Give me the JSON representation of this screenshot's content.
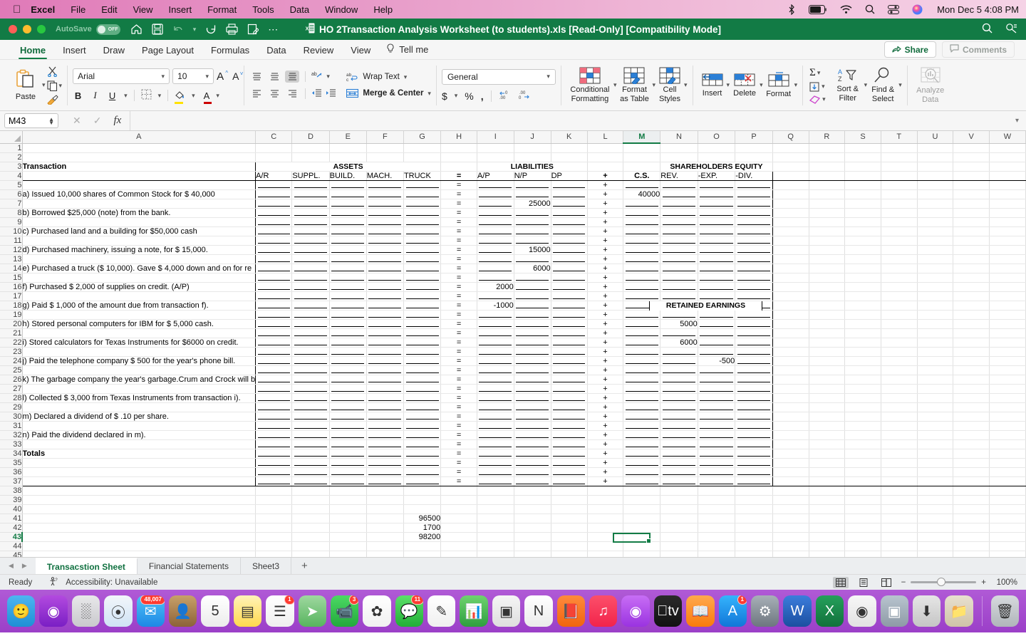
{
  "macos": {
    "apple_icon": "apple-icon",
    "menus": [
      "Excel",
      "File",
      "Edit",
      "View",
      "Insert",
      "Format",
      "Tools",
      "Data",
      "Window",
      "Help"
    ],
    "status_icons": [
      "bluetooth-icon",
      "battery-icon",
      "wifi-icon",
      "search-icon",
      "controlcenter-icon",
      "siri-icon"
    ],
    "clock": "Mon Dec 5  4:08 PM"
  },
  "titlebar": {
    "autosave_label": "AutoSave",
    "autosave_state": "OFF",
    "quick_access": [
      "home-icon",
      "save-icon",
      "undo-icon",
      "undo-chevron-icon",
      "redo-icon",
      "print-icon",
      "quickprint-icon",
      "more-icon"
    ],
    "document_title": "HO 2Transaction Analysis Worksheet (to students).xls  [Read-Only]  [Compatibility Mode]",
    "right_icons": [
      "search-icon",
      "ribbon-display-icon"
    ]
  },
  "ribbon": {
    "tabs": [
      "Home",
      "Insert",
      "Draw",
      "Page Layout",
      "Formulas",
      "Data",
      "Review",
      "View"
    ],
    "active_tab": "Home",
    "tell_me": "Tell me",
    "share_label": "Share",
    "comments_label": "Comments",
    "clipboard": {
      "paste_label": "Paste",
      "cut_label": "cut-icon",
      "copy_label": "copy-icon",
      "format_painter_label": "format-painter-icon"
    },
    "font": {
      "family": "Arial",
      "size": "10",
      "grow_label": "A",
      "shrink_label": "A",
      "bold": "B",
      "italic": "I",
      "underline": "U"
    },
    "alignment": {
      "wrap_text": "Wrap Text",
      "merge_center": "Merge & Center"
    },
    "number": {
      "format": "General",
      "currency": "$",
      "percent": "%",
      "comma": ","
    },
    "styles": {
      "conditional_formatting": "Conditional\nFormatting",
      "conditional_formatting_l1": "Conditional",
      "conditional_formatting_l2": "Formatting",
      "format_as_table_l1": "Format",
      "format_as_table_l2": "as Table",
      "cell_styles_l1": "Cell",
      "cell_styles_l2": "Styles"
    },
    "cells": {
      "insert": "Insert",
      "delete": "Delete",
      "format": "Format"
    },
    "editing": {
      "sort_filter_l1": "Sort &",
      "sort_filter_l2": "Filter",
      "find_select_l1": "Find &",
      "find_select_l2": "Select"
    },
    "analyze": {
      "l1": "Analyze",
      "l2": "Data"
    }
  },
  "formula_bar": {
    "name_box": "M43",
    "cancel_icon": "close-icon",
    "confirm_icon": "check-icon",
    "function_icon": "fx-icon",
    "value": ""
  },
  "grid": {
    "columns": [
      "A",
      "C",
      "D",
      "E",
      "F",
      "G",
      "H",
      "I",
      "J",
      "K",
      "L",
      "M",
      "N",
      "O",
      "P",
      "Q",
      "R",
      "S",
      "T",
      "U",
      "V",
      "W"
    ],
    "selected_column": "M",
    "selected_cell": "M43",
    "rows": [
      1,
      2,
      3,
      4,
      5,
      6,
      7,
      8,
      9,
      10,
      11,
      12,
      13,
      14,
      15,
      16,
      17,
      18,
      19,
      20,
      21,
      22,
      23,
      24,
      25,
      26,
      27,
      28,
      29,
      30,
      31,
      32,
      33,
      34,
      35,
      36,
      37,
      38,
      39,
      40,
      41,
      42,
      43,
      44,
      45
    ],
    "selected_row": 43,
    "headers": {
      "transaction": "Transaction",
      "assets": "ASSETS",
      "liabilities": "LIABILITIES",
      "shareholders_equity": "SHAREHOLDERS EQUITY",
      "retained_earnings": "RETAINED EARNINGS",
      "col_ar": "A/R",
      "col_suppl": "SUPPL.",
      "col_build": "BUILD.",
      "col_mach": "MACH.",
      "col_truck": "TRUCK",
      "col_eq": "=",
      "col_ap": "A/P",
      "col_np": "N/P",
      "col_dp": "DP",
      "col_plus": "+",
      "col_cs": "C.S.",
      "col_rev": "REV.",
      "col_exp": "-EXP.",
      "col_div": "-DIV."
    },
    "transactions": [
      {
        "row": 6,
        "text": "a) Issued 10,000 shares of Common Stock for $ 40,000"
      },
      {
        "row": 8,
        "text": "b) Borrowed $25,000 (note) from the bank."
      },
      {
        "row": 10,
        "text": "c) Purchased land and a building for $50,000 cash"
      },
      {
        "row": 12,
        "text": "d) Purchased machinery, issuing a note, for $ 15,000."
      },
      {
        "row": 14,
        "text": "e) Purchased a truck ($ 10,000). Gave $ 4,000 down and on for re"
      },
      {
        "row": 16,
        "text": "f) Purchased $ 2,000 of supplies on credit. (A/P)"
      },
      {
        "row": 18,
        "text": "g) Paid $ 1,000 of the amount due from transaction f)."
      },
      {
        "row": 20,
        "text": "h) Stored personal computers for IBM for $ 5,000 cash."
      },
      {
        "row": 22,
        "text": "i) Stored calculators for Texas Instruments for $6000 on credit."
      },
      {
        "row": 24,
        "text": "j) Paid the telephone company $ 500 for the year's phone bill."
      },
      {
        "row": 26,
        "text": "k) The garbage company the year's garbage.Crum and Crock will b"
      },
      {
        "row": 28,
        "text": "l) Collected $ 3,000 from Texas Instruments  from transaction i)."
      },
      {
        "row": 30,
        "text": "m) Declared a dividend of $ .10 per share."
      },
      {
        "row": 32,
        "text": "n) Paid the dividend declared in m)."
      },
      {
        "row": 34,
        "text": "Totals"
      }
    ],
    "values": [
      {
        "row": 6,
        "col": "M",
        "value": "40000"
      },
      {
        "row": 7,
        "col": "J",
        "value": "25000"
      },
      {
        "row": 12,
        "col": "J",
        "value": "15000"
      },
      {
        "row": 14,
        "col": "J",
        "value": "6000"
      },
      {
        "row": 16,
        "col": "I",
        "value": "2000"
      },
      {
        "row": 18,
        "col": "I",
        "value": "-1000"
      },
      {
        "row": 20,
        "col": "N",
        "value": "5000"
      },
      {
        "row": 22,
        "col": "N",
        "value": "6000"
      },
      {
        "row": 24,
        "col": "O",
        "value": "-500"
      },
      {
        "row": 41,
        "col": "G",
        "value": "96500"
      },
      {
        "row": 42,
        "col": "G",
        "value": "1700"
      },
      {
        "row": 43,
        "col": "G",
        "value": "98200"
      }
    ]
  },
  "sheet_tabs": {
    "tabs": [
      "Transacstion Sheet",
      "Financial Statements",
      "Sheet3"
    ],
    "active": "Transacstion Sheet",
    "add_label": "+",
    "prev_icon": "chevron-left-icon",
    "next_icon": "chevron-right-icon"
  },
  "status_bar": {
    "state": "Ready",
    "accessibility": "Accessibility: Unavailable",
    "views": [
      "normal-view-icon",
      "page-layout-icon",
      "page-break-icon"
    ],
    "active_view": "normal-view-icon",
    "zoom_out": "−",
    "zoom_in": "+",
    "zoom_level": "100%"
  },
  "dock": {
    "items": [
      {
        "name": "finder-icon",
        "color1": "#4eb5f1",
        "color2": "#1e8fd5",
        "glyph": "🙂",
        "badge": ""
      },
      {
        "name": "podcasts-icon",
        "color1": "#b34adf",
        "color2": "#7a1fc4",
        "glyph": "◉",
        "badge": ""
      },
      {
        "name": "launchpad-icon",
        "color1": "#e8e8ea",
        "color2": "#c9c9cd",
        "glyph": "░",
        "badge": ""
      },
      {
        "name": "safari-icon",
        "color1": "#f2f6fa",
        "color2": "#cfe3f5",
        "glyph": "⦿",
        "badge": ""
      },
      {
        "name": "mail-icon",
        "color1": "#4fc3f7",
        "color2": "#1e88e5",
        "glyph": "✉",
        "badge": "48,007"
      },
      {
        "name": "contacts-icon",
        "color1": "#c8a169",
        "color2": "#8c6239",
        "glyph": "👤",
        "badge": ""
      },
      {
        "name": "calendar-icon",
        "color1": "#ffffff",
        "color2": "#ececec",
        "glyph": "5",
        "badge": ""
      },
      {
        "name": "notes-icon",
        "color1": "#fff4b8",
        "color2": "#ffd84d",
        "glyph": "▤",
        "badge": ""
      },
      {
        "name": "reminders-icon",
        "color1": "#ffffff",
        "color2": "#efefef",
        "glyph": "☰",
        "badge": "1"
      },
      {
        "name": "maps-icon",
        "color1": "#9fd8a0",
        "color2": "#57b45e",
        "glyph": "➤",
        "badge": ""
      },
      {
        "name": "facetime-icon",
        "color1": "#4cd964",
        "color2": "#23a93c",
        "glyph": "📹",
        "badge": "3"
      },
      {
        "name": "photos-icon",
        "color1": "#ffffff",
        "color2": "#f0f0f0",
        "glyph": "✿",
        "badge": ""
      },
      {
        "name": "messages-icon",
        "color1": "#5ce06a",
        "color2": "#22ae37",
        "glyph": "💬",
        "badge": "11"
      },
      {
        "name": "freeform-icon",
        "color1": "#ffffff",
        "color2": "#efefef",
        "glyph": "✎",
        "badge": ""
      },
      {
        "name": "numbers-icon",
        "color1": "#6fd36f",
        "color2": "#2e9e3f",
        "glyph": "📊",
        "badge": ""
      },
      {
        "name": "keynote-icon",
        "color1": "#f5f5f5",
        "color2": "#dedede",
        "glyph": "▣",
        "badge": ""
      },
      {
        "name": "news-icon",
        "color1": "#ffffff",
        "color2": "#ebebeb",
        "glyph": "N",
        "badge": ""
      },
      {
        "name": "books-icon",
        "color1": "#ff8a3d",
        "color2": "#f0650e",
        "glyph": "📕",
        "badge": ""
      },
      {
        "name": "music-icon",
        "color1": "#fc4f6a",
        "color2": "#f2244b",
        "glyph": "♫",
        "badge": ""
      },
      {
        "name": "podcast2-icon",
        "color1": "#c86ef5",
        "color2": "#9a33e0",
        "glyph": "◉",
        "badge": ""
      },
      {
        "name": "appletv-icon",
        "color1": "#2b2b2b",
        "color2": "#111111",
        "glyph": "tv",
        "badge": ""
      },
      {
        "name": "ibooks-icon",
        "color1": "#ffa94d",
        "color2": "#f97b0c",
        "glyph": "📖",
        "badge": ""
      },
      {
        "name": "appstore-icon",
        "color1": "#35b4fc",
        "color2": "#1176d8",
        "glyph": "A",
        "badge": "1"
      },
      {
        "name": "settings-icon",
        "color1": "#a8b0b8",
        "color2": "#6d767f",
        "glyph": "⚙",
        "badge": ""
      },
      {
        "name": "word-icon",
        "color1": "#3c7ddc",
        "color2": "#1b4fa0",
        "glyph": "W",
        "badge": ""
      },
      {
        "name": "excel-icon",
        "color1": "#25a05b",
        "color2": "#11713c",
        "glyph": "X",
        "badge": ""
      },
      {
        "name": "chrome-icon",
        "color1": "#f7f7f7",
        "color2": "#e2e2e2",
        "glyph": "◉",
        "badge": ""
      },
      {
        "name": "preview-icon",
        "color1": "#b8c4cf",
        "color2": "#8e9aa6",
        "glyph": "▣",
        "badge": ""
      },
      {
        "name": "downloads-icon",
        "color1": "#e6e6e6",
        "color2": "#c5c5c5",
        "glyph": "⬇",
        "badge": ""
      },
      {
        "name": "folder-icon",
        "color1": "#e8e0cf",
        "color2": "#cfc3a8",
        "glyph": "📁",
        "badge": ""
      },
      {
        "name": "trash-icon",
        "color1": "#d7dade",
        "color2": "#b0b5ba",
        "glyph": "🗑",
        "badge": ""
      }
    ]
  }
}
